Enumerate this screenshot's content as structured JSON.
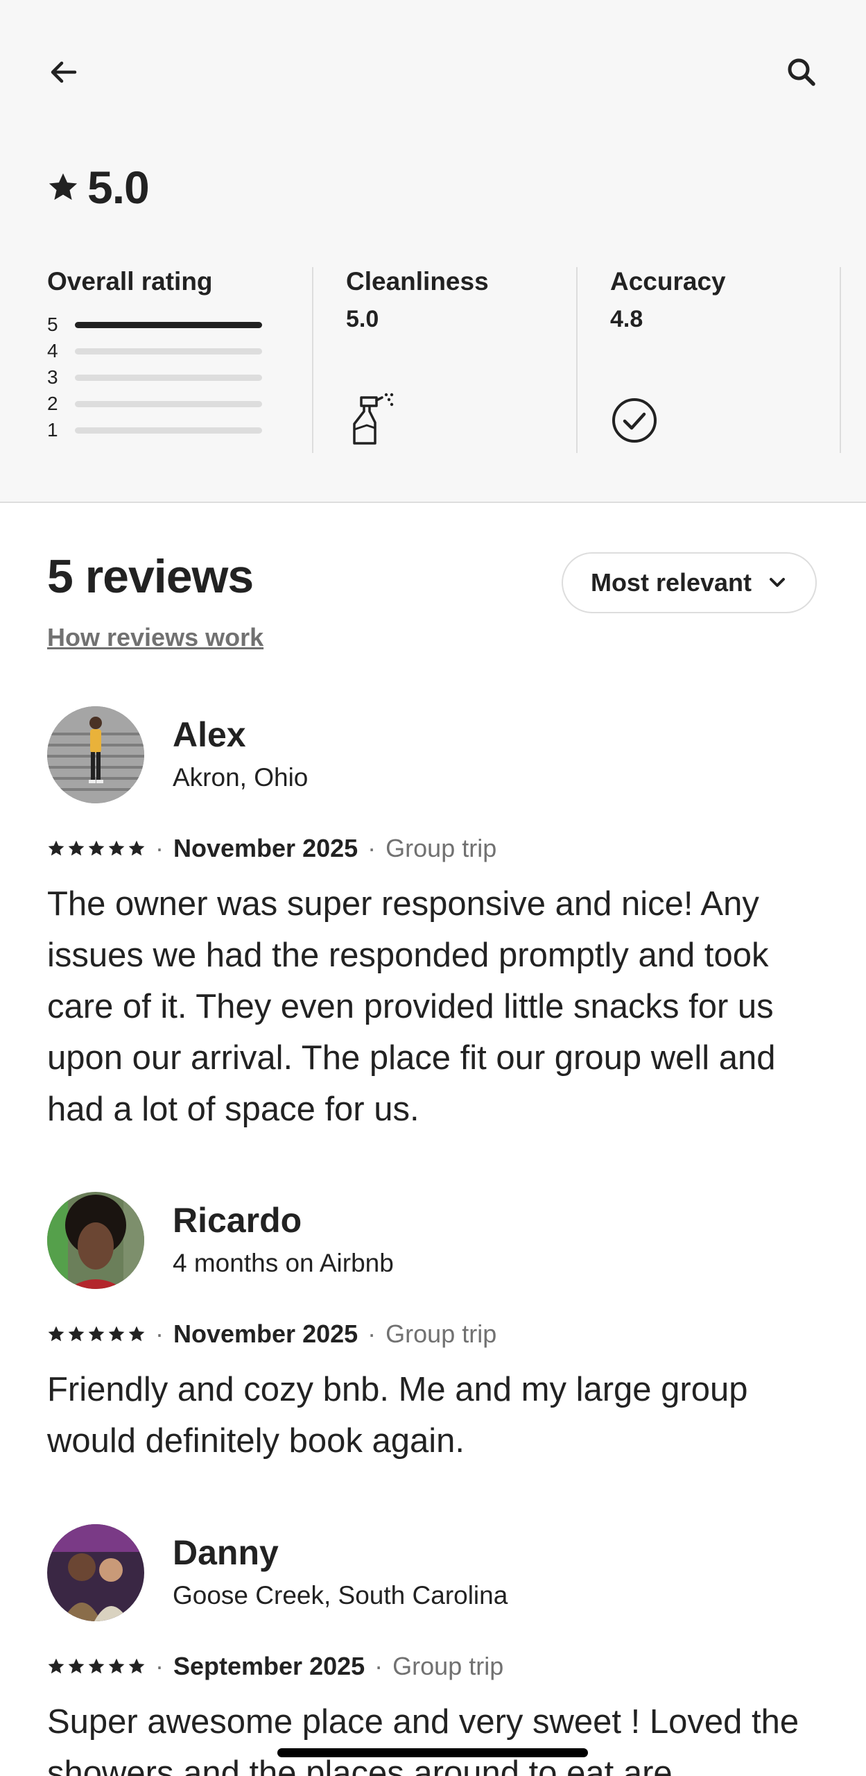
{
  "header": {
    "back_icon": "arrow-left-icon",
    "search_icon": "search-icon"
  },
  "rating": {
    "value": "5.0",
    "star_icon": "star-icon"
  },
  "overall": {
    "title": "Overall rating",
    "rows": [
      {
        "label": "5",
        "fraction": 1.0
      },
      {
        "label": "4",
        "fraction": 0.0
      },
      {
        "label": "3",
        "fraction": 0.0
      },
      {
        "label": "2",
        "fraction": 0.0
      },
      {
        "label": "1",
        "fraction": 0.0
      }
    ]
  },
  "categories": [
    {
      "title": "Cleanliness",
      "value": "5.0",
      "icon": "spray-bottle-icon"
    },
    {
      "title": "Accuracy",
      "value": "4.8",
      "icon": "check-circle-icon"
    }
  ],
  "reviews_section": {
    "title": "5 reviews",
    "how_link": "How reviews work",
    "sort_label": "Most relevant"
  },
  "reviews": [
    {
      "name": "Alex",
      "subtitle": "Akron, Ohio",
      "rating": 5,
      "date": "November 2025",
      "trip": "Group trip",
      "text": "The owner was super responsive and nice! Any issues we had the responded promptly and took care of it. They even provided little snacks for us upon our arrival. The place fit our group well and had a lot of space for us."
    },
    {
      "name": "Ricardo",
      "subtitle": "4 months on Airbnb",
      "rating": 5,
      "date": "November 2025",
      "trip": "Group trip",
      "text": "Friendly and cozy bnb. Me and my large group would definitely book again."
    },
    {
      "name": "Danny",
      "subtitle": "Goose Creek, South Carolina",
      "rating": 5,
      "date": "September 2025",
      "trip": "Group trip",
      "text": "Super awesome place and very sweet ! Loved the showers and the places around to eat are"
    }
  ],
  "separator": "·",
  "colors": {
    "text": "#222222",
    "muted": "#717171",
    "border": "#dddddd",
    "top_bg": "#f7f7f7"
  }
}
